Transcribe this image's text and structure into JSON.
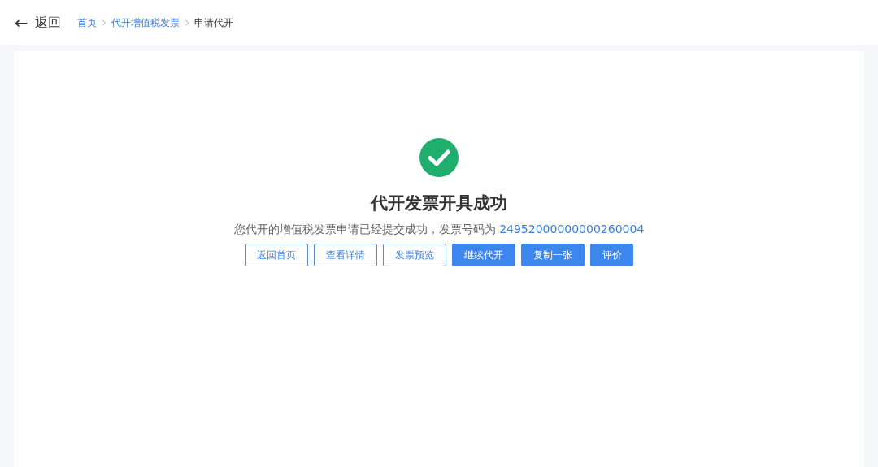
{
  "header": {
    "back": {
      "arrow": "←",
      "label": "返回"
    },
    "breadcrumb": [
      {
        "label": "首页",
        "current": false
      },
      {
        "label": "代开增值税发票",
        "current": false
      },
      {
        "label": "申请代开",
        "current": true
      }
    ]
  },
  "result": {
    "title": "代开发票开具成功",
    "message": "您代开的增值税发票申请已经提交成功，发票号码为",
    "invoice_number": "24952000000000260004",
    "buttons": [
      {
        "label": "返回首页",
        "kind": "outline"
      },
      {
        "label": "查看详情",
        "kind": "outline"
      },
      {
        "label": "发票预览",
        "kind": "outline"
      },
      {
        "label": "继续代开",
        "kind": "primary"
      },
      {
        "label": "复制一张",
        "kind": "primary"
      },
      {
        "label": "评价",
        "kind": "primary"
      }
    ]
  }
}
